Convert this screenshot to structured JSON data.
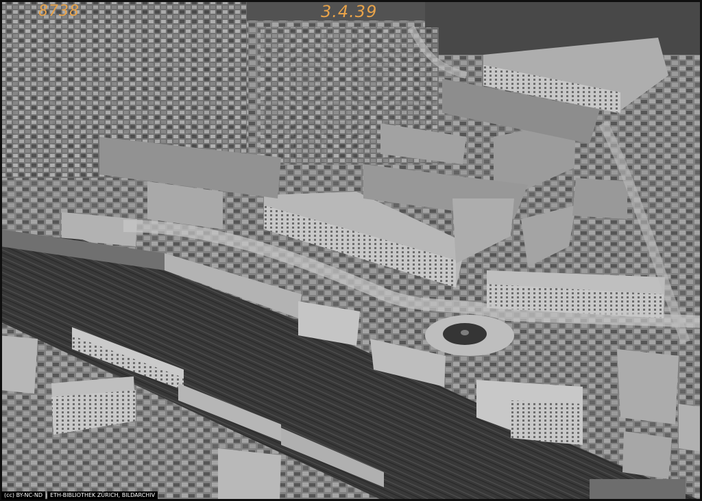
{
  "photo": {
    "scan_number_left": "8738",
    "scan_number_right": "3.4.39",
    "license_badge": "(cc) BY-NC-ND",
    "credit": "ETH-BIBLIOTHEK ZÜRICH, BILDARCHIV"
  }
}
